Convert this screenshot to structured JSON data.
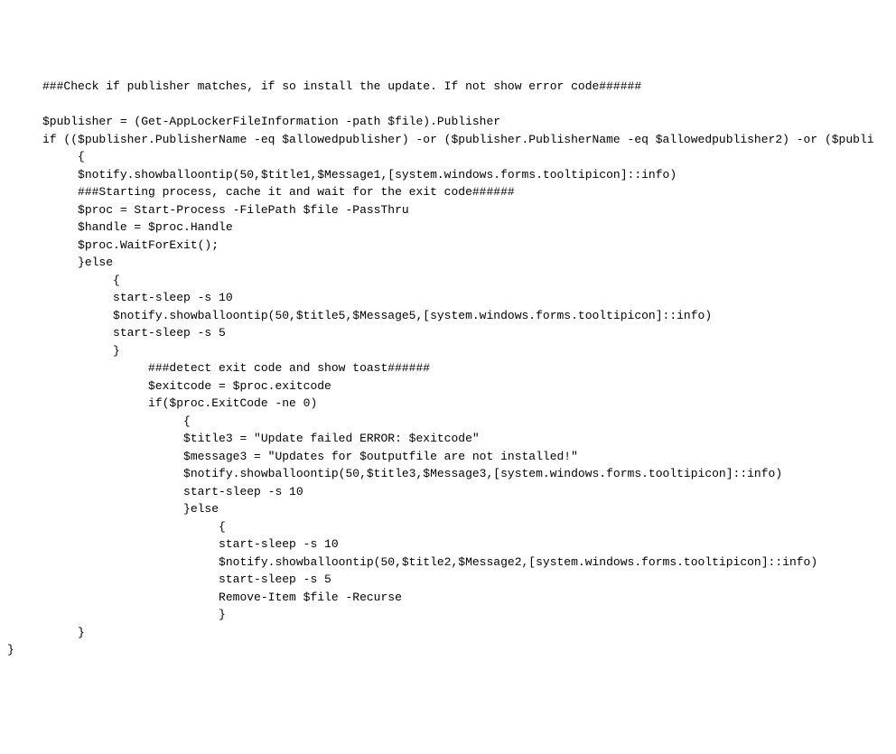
{
  "code": {
    "lines": [
      "     ###Check if publisher matches, if so install the update. If not show error code######",
      "",
      "     $publisher = (Get-AppLockerFileInformation -path $file).Publisher",
      "     if (($publisher.PublisherName -eq $allowedpublisher) -or ($publisher.PublisherName -eq $allowedpublisher2) -or ($publi",
      "          {",
      "          $notify.showballoontip(50,$title1,$Message1,[system.windows.forms.tooltipicon]::info)",
      "          ###Starting process, cache it and wait for the exit code######",
      "          $proc = Start-Process -FilePath $file -PassThru",
      "          $handle = $proc.Handle",
      "          $proc.WaitForExit();",
      "          }else",
      "               {",
      "               start-sleep -s 10",
      "               $notify.showballoontip(50,$title5,$Message5,[system.windows.forms.tooltipicon]::info)",
      "               start-sleep -s 5",
      "               }",
      "                    ###detect exit code and show toast######",
      "                    $exitcode = $proc.exitcode",
      "                    if($proc.ExitCode -ne 0)",
      "                         {",
      "                         $title3 = \"Update failed ERROR: $exitcode\"",
      "                         $message3 = \"Updates for $outputfile are not installed!\"",
      "                         $notify.showballoontip(50,$title3,$Message3,[system.windows.forms.tooltipicon]::info)",
      "                         start-sleep -s 10",
      "                         }else",
      "                              {",
      "                              start-sleep -s 10",
      "                              $notify.showballoontip(50,$title2,$Message2,[system.windows.forms.tooltipicon]::info)",
      "                              start-sleep -s 5",
      "                              Remove-Item $file -Recurse",
      "                              }",
      "          }",
      "}"
    ]
  }
}
